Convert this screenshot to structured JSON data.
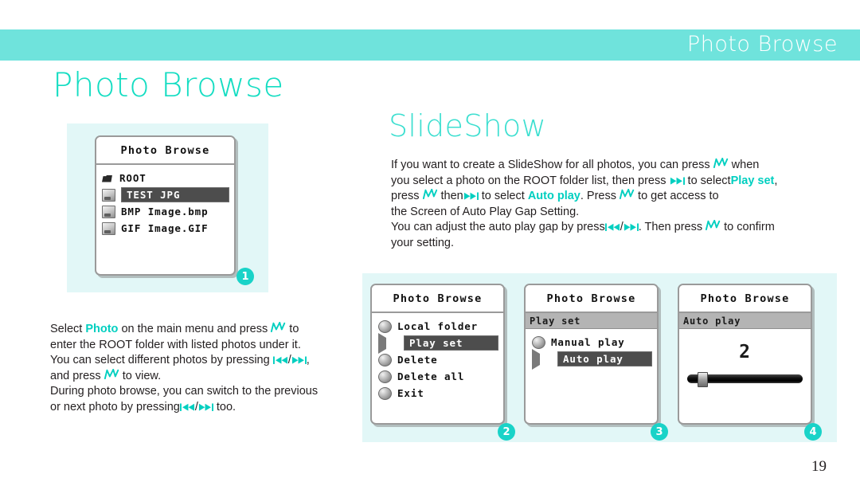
{
  "header": {
    "bar_title": "Photo Browse",
    "page_title": "Photo Browse",
    "bar_color": "#6fe3dc",
    "title_color": "#14ddc2"
  },
  "section": {
    "title": "SlideShow",
    "title_color": "#3ddfd0"
  },
  "left_copy": {
    "line1_a": "Select ",
    "line1_hl": "Photo",
    "line1_b": " on the main menu and press ",
    "line1_c": " to",
    "line2": "enter the ROOT folder with listed photos under it.",
    "line3_a": "You can select different photos by pressing ",
    "line3_sep": "/",
    "line3_b": ",",
    "line4_a": "and press ",
    "line4_b": " to view.",
    "line5": "During photo browse, you can switch to the previous",
    "line6_a": "or next photo by pressing",
    "line6_sep": "/",
    "line6_b": " too."
  },
  "right_copy": {
    "p1_a": "If you want to create a SlideShow for all photos, you can press ",
    "p1_b": " when",
    "p2_a": "you select a photo on the ROOT folder list, then press ",
    "p2_b": " to select",
    "p2_hl": "Play set",
    "p2_c": ",",
    "p3_a": "press ",
    "p3_b": " then",
    "p3_c": " to select ",
    "p3_hl": "Auto play",
    "p3_d": ". Press ",
    "p3_e": " to get access to",
    "p4": "the Screen of Auto Play Gap Setting.",
    "p5_a": "You can adjust the auto play gap by press",
    "p5_sep": "/",
    "p5_b": ". Then press ",
    "p5_c": " to confirm",
    "p6": "your setting."
  },
  "screens": [
    {
      "badge": "1",
      "title": "Photo Browse",
      "subheader": null,
      "items": [
        {
          "icon": "folder-icon",
          "label": "ROOT",
          "selected": false
        },
        {
          "icon": "file-icon",
          "label": "TEST JPG",
          "selected": true
        },
        {
          "icon": "file-icon",
          "label": "BMP Image.bmp",
          "selected": false
        },
        {
          "icon": "file-icon",
          "label": "GIF Image.GIF",
          "selected": false
        }
      ]
    },
    {
      "badge": "2",
      "title": "Photo Browse",
      "subheader": null,
      "items": [
        {
          "icon": "bullet-icon",
          "label": "Local folder",
          "selected": false
        },
        {
          "icon": "play-arrow-icon",
          "label": "Play set",
          "selected": true
        },
        {
          "icon": "bullet-icon",
          "label": "Delete",
          "selected": false
        },
        {
          "icon": "bullet-icon",
          "label": "Delete all",
          "selected": false
        },
        {
          "icon": "bullet-icon",
          "label": "Exit",
          "selected": false
        }
      ]
    },
    {
      "badge": "3",
      "title": "Photo Browse",
      "subheader": "Play set",
      "items": [
        {
          "icon": "bullet-icon",
          "label": "Manual play",
          "selected": false
        },
        {
          "icon": "play-arrow-icon",
          "label": "Auto play",
          "selected": true
        }
      ]
    },
    {
      "badge": "4",
      "title": "Photo Browse",
      "subheader": "Auto play",
      "items": [],
      "gap_value": "2"
    }
  ],
  "footer": {
    "page_number": "19"
  }
}
